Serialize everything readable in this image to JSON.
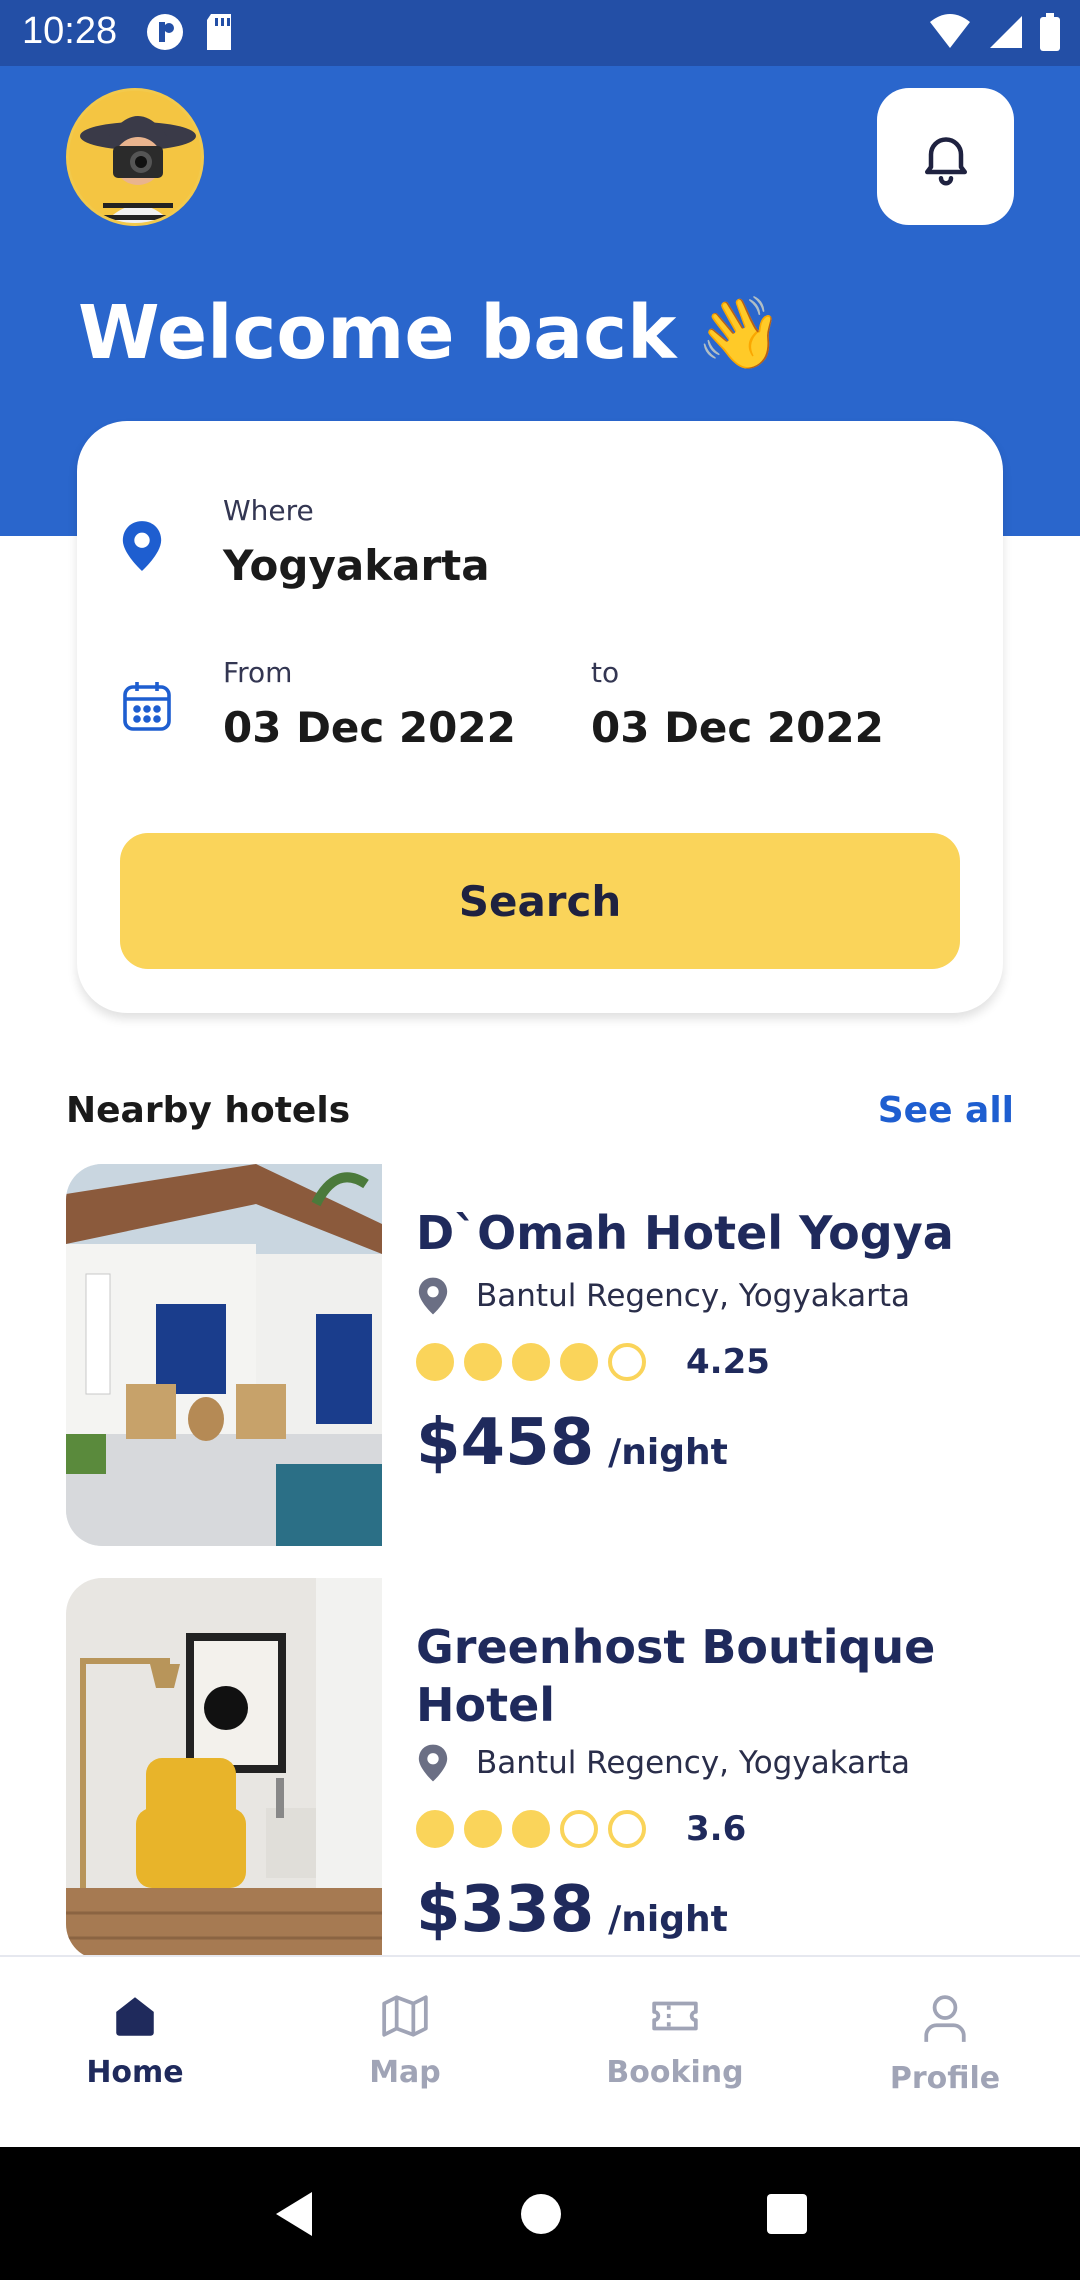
{
  "status_bar": {
    "time": "10:28"
  },
  "header": {
    "welcome_text": "Welcome back",
    "wave_emoji": "👋"
  },
  "search_card": {
    "where_label": "Where",
    "where_value": "Yogyakarta",
    "from_label": "From",
    "from_value": "03 Dec 2022",
    "to_label": "to",
    "to_value": "03 Dec 2022",
    "search_label": "Search"
  },
  "nearby": {
    "title": "Nearby hotels",
    "see_all": "See all"
  },
  "hotels": [
    {
      "name": "D`Omah Hotel Yogya",
      "location": "Bantul Regency, Yogyakarta",
      "rating": "4.25",
      "rating_filled": 4,
      "price": "$458",
      "unit": "/night"
    },
    {
      "name": "Greenhost Boutique Hotel",
      "location": "Bantul Regency, Yogyakarta",
      "rating": "3.6",
      "rating_filled": 3,
      "price": "$338",
      "unit": "/night"
    }
  ],
  "bottom_nav": [
    {
      "label": "Home",
      "icon": "home-icon",
      "active": true
    },
    {
      "label": "Map",
      "icon": "map-icon",
      "active": false
    },
    {
      "label": "Booking",
      "icon": "ticket-icon",
      "active": false
    },
    {
      "label": "Profile",
      "icon": "person-icon",
      "active": false
    }
  ],
  "colors": {
    "primary_blue": "#2a66cc",
    "accent_yellow": "#fad45a",
    "navy": "#1f2a5c",
    "link_blue": "#1e5ed0"
  }
}
